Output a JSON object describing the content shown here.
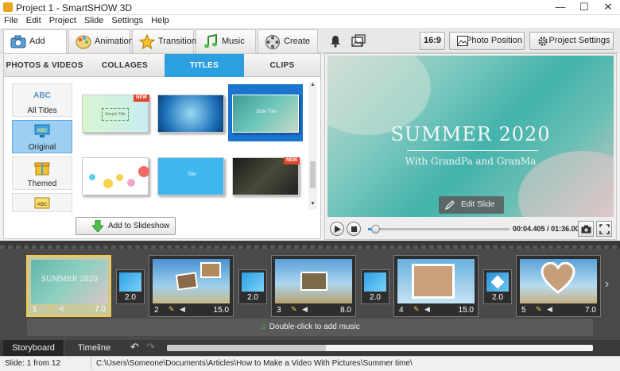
{
  "window": {
    "title": "Project 1 - SmartSHOW 3D",
    "minimize": "—",
    "maximize": "☐",
    "close": "✕"
  },
  "menu": [
    "File",
    "Edit",
    "Project",
    "Slide",
    "Settings",
    "Help"
  ],
  "main_tabs": [
    {
      "label": "Add"
    },
    {
      "label": "Animation"
    },
    {
      "label": "Transitions"
    },
    {
      "label": "Music"
    },
    {
      "label": "Create"
    }
  ],
  "right_toolbar": {
    "aspect_ratio": "16:9",
    "photo_position": "Photo Position",
    "project_settings": "Project Settings"
  },
  "library": {
    "subtabs": [
      "PHOTOS & VIDEOS",
      "COLLAGES",
      "TITLES",
      "CLIPS"
    ],
    "active_subtab": "TITLES",
    "categories": [
      {
        "label": "All Titles",
        "icon": "abc-icon"
      },
      {
        "label": "Original",
        "icon": "abc-monitor-icon"
      },
      {
        "label": "Themed",
        "icon": "gift-icon"
      }
    ],
    "active_category": "Original",
    "thumbnails": [
      {
        "text": "Simple Title",
        "badge": "NEW"
      },
      {
        "text": "",
        "badge": ""
      },
      {
        "text": "Slide Title",
        "badge": ""
      },
      {
        "text": "",
        "badge": ""
      },
      {
        "text": "Title",
        "badge": ""
      },
      {
        "text": "",
        "badge": "NEW"
      }
    ],
    "add_button": "Add to Slideshow"
  },
  "preview": {
    "title": "SUMMER 2020",
    "subtitle": "With GrandPa and GranMa",
    "edit_button": "Edit Slide",
    "time_current": "00:04.405",
    "time_total": "01:36.000",
    "progress": 0.05
  },
  "storyboard": {
    "slides": [
      {
        "num": "1",
        "duration": "7.0",
        "caption": "SUMMER 2020"
      },
      {
        "num": "2",
        "duration": "15.0",
        "caption": ""
      },
      {
        "num": "3",
        "duration": "8.0",
        "caption": ""
      },
      {
        "num": "4",
        "duration": "15.0",
        "caption": ""
      },
      {
        "num": "5",
        "duration": "7.0",
        "caption": ""
      }
    ],
    "transitions": [
      "2.0",
      "2.0",
      "2.0",
      "2.0"
    ],
    "music_hint": "Double-click to add music"
  },
  "bottom_tabs": [
    "Storyboard",
    "Timeline"
  ],
  "status": {
    "slide": "Slide: 1 from 12",
    "path": "C:\\Users\\Someone\\Documents\\Articles\\How to Make a Video With Pictures\\Summer time\\"
  }
}
